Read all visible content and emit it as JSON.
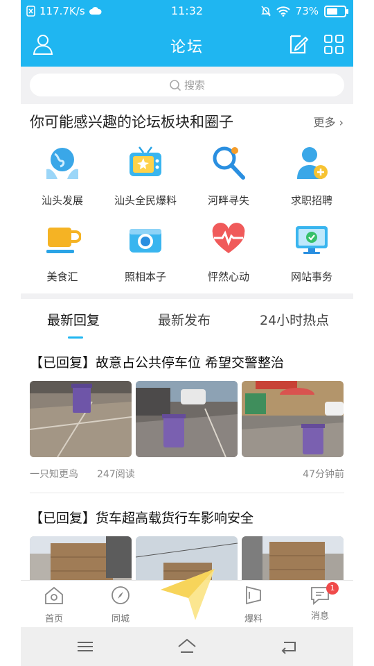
{
  "status_bar": {
    "speed": "117.7K/s",
    "time": "11:32",
    "battery": "73%",
    "battery_level": 0.73,
    "icons": [
      "sim-icon",
      "cloud-icon",
      "mute-icon",
      "wifi-icon",
      "battery-icon"
    ]
  },
  "header": {
    "title": "论坛",
    "left_icon": "user-icon",
    "right_icons": [
      "edit-icon",
      "grid-icon"
    ]
  },
  "search": {
    "placeholder": "搜索",
    "icon": "search-icon"
  },
  "forums": {
    "heading": "你可能感兴趣的论坛板块和圈子",
    "more": "更多",
    "items": [
      {
        "label": "汕头发展",
        "icon": "globe-hands-icon"
      },
      {
        "label": "汕头全民爆料",
        "icon": "tv-icon"
      },
      {
        "label": "河畔寻失",
        "icon": "magnifier-icon"
      },
      {
        "label": "求职招聘",
        "icon": "person-plus-icon"
      },
      {
        "label": "美食汇",
        "icon": "cup-icon"
      },
      {
        "label": "照相本子",
        "icon": "camera-icon"
      },
      {
        "label": "怦然心动",
        "icon": "heartbeat-icon"
      },
      {
        "label": "网站事务",
        "icon": "monitor-check-icon"
      }
    ]
  },
  "tabs": [
    {
      "label": "最新回复",
      "active": true
    },
    {
      "label": "最新发布",
      "active": false
    },
    {
      "label": "24小时热点",
      "active": false
    }
  ],
  "posts": [
    {
      "title": "【已回复】故意占公共停车位 希望交警整治",
      "author": "一只知更鸟",
      "reads": "247阅读",
      "time": "47分钟前"
    },
    {
      "title": "【已回复】货车超高载货行车影响安全"
    }
  ],
  "bottom_nav": [
    {
      "label": "首页",
      "icon": "home-icon"
    },
    {
      "label": "同城",
      "icon": "compass-icon"
    },
    {
      "label": "",
      "icon": "center-icon"
    },
    {
      "label": "爆料",
      "icon": "flag-icon"
    },
    {
      "label": "消息",
      "icon": "message-icon",
      "badge": "1"
    }
  ],
  "colors": {
    "primary": "#1fb6f1",
    "badge": "#f04a4a"
  }
}
